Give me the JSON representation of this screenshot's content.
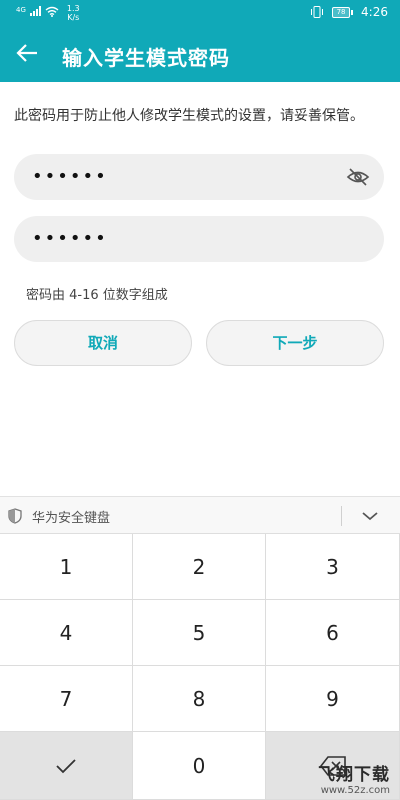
{
  "status_bar": {
    "network_type": "4G",
    "speed_value": "1.3",
    "speed_unit": "K/s",
    "battery": "78",
    "time": "4:26"
  },
  "header": {
    "title": "输入学生模式密码",
    "background_color": "#10a9b8"
  },
  "form": {
    "description": "此密码用于防止他人修改学生模式的设置，请妥善保管。",
    "password_mask": "••••••",
    "confirm_password_mask": "••••••",
    "hint": "密码由 4-16 位数字组成"
  },
  "buttons": {
    "cancel": "取消",
    "next": "下一步",
    "accent_color": "#10a9b8"
  },
  "keyboard": {
    "title": "华为安全键盘",
    "keys": [
      "1",
      "2",
      "3",
      "4",
      "5",
      "6",
      "7",
      "8",
      "9",
      "0"
    ],
    "confirm_icon": "check-icon",
    "delete_icon": "backspace-icon"
  },
  "watermark": {
    "logo_text": "飞翔下载",
    "url": "www.52z.com"
  }
}
